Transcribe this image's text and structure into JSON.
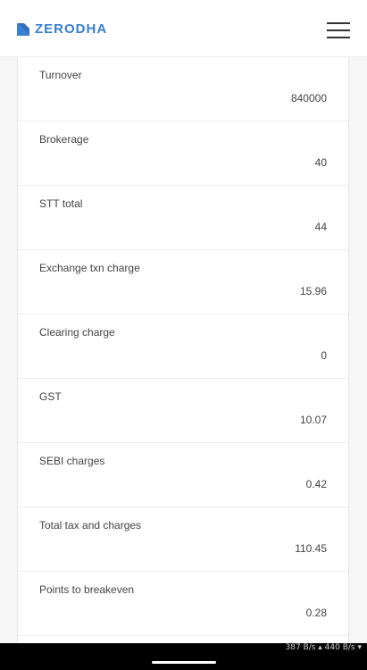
{
  "header": {
    "brand": "ZERODHA",
    "brand_color": "#387ed1",
    "menu_icon": "hamburger-menu-icon"
  },
  "rows": [
    {
      "label": "Turnover",
      "value": "840000"
    },
    {
      "label": "Brokerage",
      "value": "40"
    },
    {
      "label": "STT total",
      "value": "44"
    },
    {
      "label": "Exchange txn charge",
      "value": "15.96"
    },
    {
      "label": "Clearing charge",
      "value": "0"
    },
    {
      "label": "GST",
      "value": "10.07"
    },
    {
      "label": "SEBI charges",
      "value": "0.42"
    },
    {
      "label": "Total tax and charges",
      "value": "110.45"
    },
    {
      "label": "Points to breakeven",
      "value": "0.28"
    }
  ],
  "system": {
    "net_speed": "387 B/s ▴  440 B/s ▾"
  }
}
